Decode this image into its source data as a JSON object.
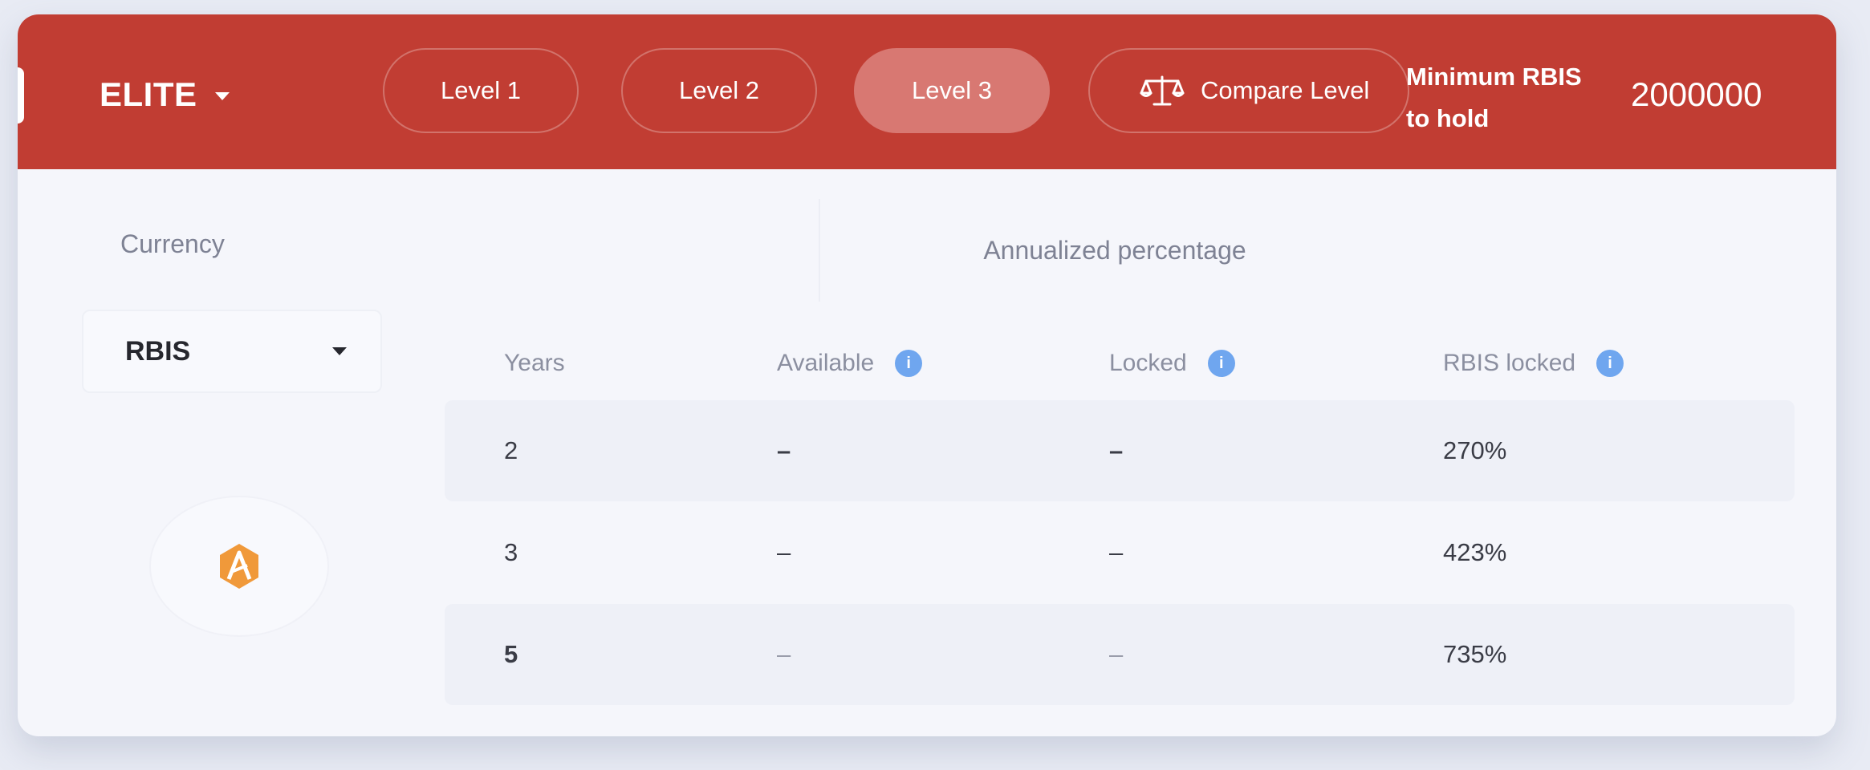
{
  "header": {
    "tier": "ELITE",
    "levels": [
      {
        "label": "Level 1",
        "active": false
      },
      {
        "label": "Level 2",
        "active": false
      },
      {
        "label": "Level 3",
        "active": true
      }
    ],
    "compare_label": "Compare Level",
    "minimum_label": "Minimum RBIS to hold",
    "minimum_value": "2000000"
  },
  "currency": {
    "label": "Currency",
    "selected": "RBIS",
    "icon": "rbis-logo-icon"
  },
  "annualized_label": "Annualized percentage",
  "table": {
    "columns": [
      "Years",
      "Available",
      "Locked",
      "RBIS locked"
    ],
    "rows": [
      {
        "years": "2",
        "available": "–",
        "locked": "–",
        "rbis_locked": "270%"
      },
      {
        "years": "3",
        "available": "–",
        "locked": "–",
        "rbis_locked": "423%"
      },
      {
        "years": "5",
        "available": "–",
        "locked": "–",
        "rbis_locked": "735%"
      }
    ]
  },
  "colors": {
    "header_bg": "#c13d33",
    "active_level_bg": "#d87872",
    "info_icon": "#6fa6ef",
    "logo_orange": "#f0993a"
  }
}
